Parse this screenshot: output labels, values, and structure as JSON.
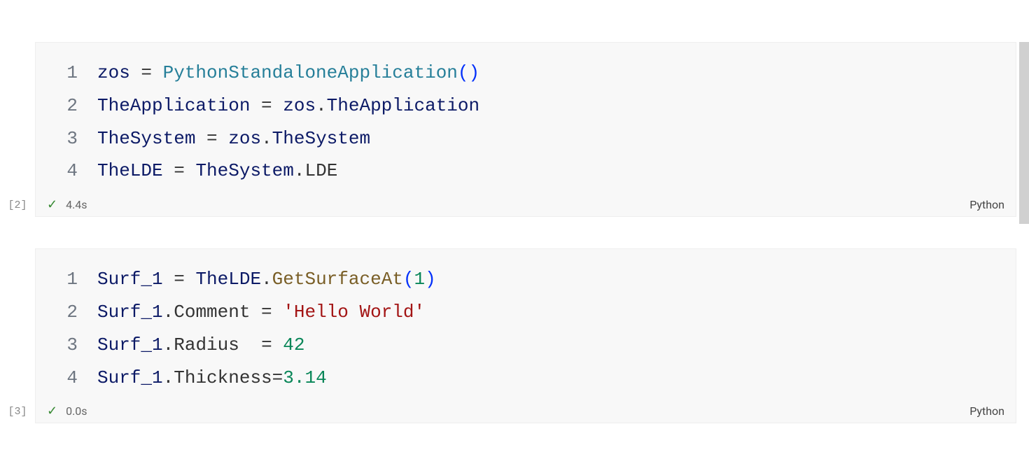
{
  "cells": [
    {
      "exec_count": "[2]",
      "exec_time": "4.4s",
      "language": "Python",
      "lines": [
        {
          "num": "1",
          "tokens": [
            {
              "t": "zos",
              "c": "tok-var"
            },
            {
              "t": " = ",
              "c": "tok-op"
            },
            {
              "t": "PythonStandaloneApplication",
              "c": "tok-class"
            },
            {
              "t": "(",
              "c": "tok-paren"
            },
            {
              "t": ")",
              "c": "tok-paren"
            }
          ]
        },
        {
          "num": "2",
          "tokens": [
            {
              "t": "TheApplication",
              "c": "tok-var"
            },
            {
              "t": " = ",
              "c": "tok-op"
            },
            {
              "t": "zos",
              "c": "tok-var"
            },
            {
              "t": ".",
              "c": "tok-dot"
            },
            {
              "t": "TheApplication",
              "c": "tok-prop"
            }
          ]
        },
        {
          "num": "3",
          "tokens": [
            {
              "t": "TheSystem",
              "c": "tok-var"
            },
            {
              "t": " = ",
              "c": "tok-op"
            },
            {
              "t": "zos",
              "c": "tok-var"
            },
            {
              "t": ".",
              "c": "tok-dot"
            },
            {
              "t": "TheSystem",
              "c": "tok-prop"
            }
          ]
        },
        {
          "num": "4",
          "tokens": [
            {
              "t": "TheLDE",
              "c": "tok-var"
            },
            {
              "t": " = ",
              "c": "tok-op"
            },
            {
              "t": "TheSystem",
              "c": "tok-var"
            },
            {
              "t": ".",
              "c": "tok-dot"
            },
            {
              "t": "LDE",
              "c": "tok-attr"
            }
          ]
        }
      ]
    },
    {
      "exec_count": "[3]",
      "exec_time": "0.0s",
      "language": "Python",
      "lines": [
        {
          "num": "1",
          "tokens": [
            {
              "t": "Surf_1",
              "c": "tok-var"
            },
            {
              "t": " = ",
              "c": "tok-op"
            },
            {
              "t": "TheLDE",
              "c": "tok-var"
            },
            {
              "t": ".",
              "c": "tok-dot"
            },
            {
              "t": "GetSurfaceAt",
              "c": "tok-func"
            },
            {
              "t": "(",
              "c": "tok-paren"
            },
            {
              "t": "1",
              "c": "tok-num"
            },
            {
              "t": ")",
              "c": "tok-paren"
            }
          ]
        },
        {
          "num": "2",
          "tokens": [
            {
              "t": "Surf_1",
              "c": "tok-var"
            },
            {
              "t": ".",
              "c": "tok-dot"
            },
            {
              "t": "Comment",
              "c": "tok-attr"
            },
            {
              "t": " = ",
              "c": "tok-op"
            },
            {
              "t": "'Hello World'",
              "c": "tok-str"
            }
          ]
        },
        {
          "num": "3",
          "tokens": [
            {
              "t": "Surf_1",
              "c": "tok-var"
            },
            {
              "t": ".",
              "c": "tok-dot"
            },
            {
              "t": "Radius",
              "c": "tok-attr"
            },
            {
              "t": "  = ",
              "c": "tok-op"
            },
            {
              "t": "42",
              "c": "tok-num"
            }
          ]
        },
        {
          "num": "4",
          "tokens": [
            {
              "t": "Surf_1",
              "c": "tok-var"
            },
            {
              "t": ".",
              "c": "tok-dot"
            },
            {
              "t": "Thickness",
              "c": "tok-attr"
            },
            {
              "t": "=",
              "c": "tok-op"
            },
            {
              "t": "3.14",
              "c": "tok-num"
            }
          ]
        }
      ]
    }
  ]
}
